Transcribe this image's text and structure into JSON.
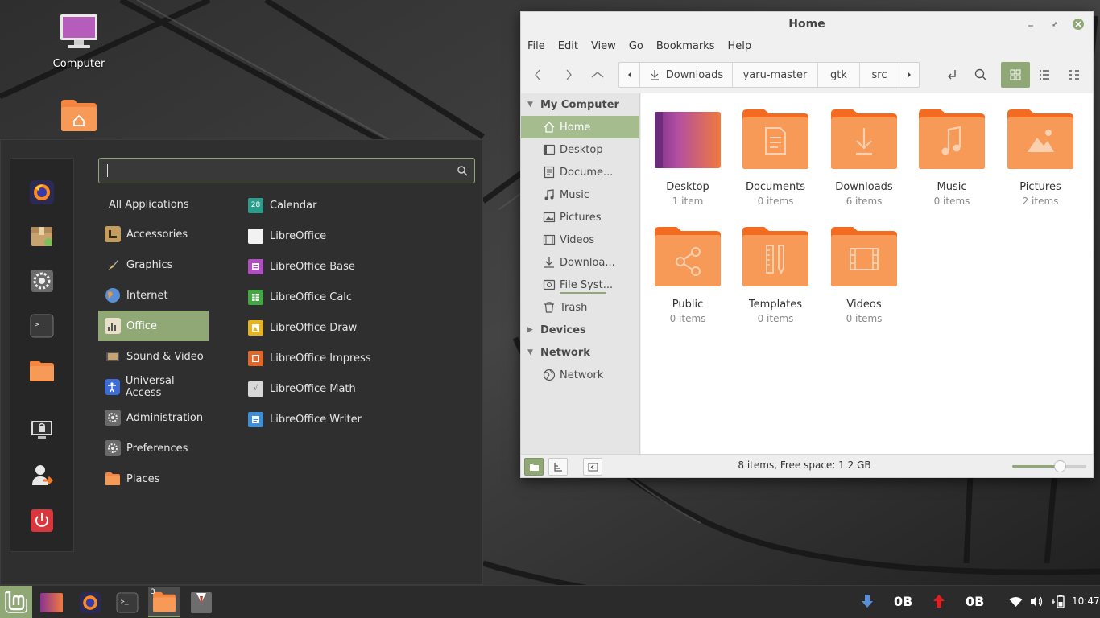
{
  "desktop": {
    "icons": [
      {
        "label": "Computer",
        "icon": "computer-icon"
      },
      {
        "label": "",
        "icon": "home-folder-icon"
      }
    ]
  },
  "menu": {
    "search": {
      "value": "",
      "placeholder": ""
    },
    "favorites": [
      "firefox-icon",
      "package-manager-icon",
      "settings-icon",
      "terminal-icon",
      "folder-icon",
      "lock-screen-icon",
      "logout-icon",
      "power-icon"
    ],
    "categories": [
      {
        "label": "All Applications"
      },
      {
        "label": "Accessories"
      },
      {
        "label": "Graphics"
      },
      {
        "label": "Internet"
      },
      {
        "label": "Office",
        "active": true
      },
      {
        "label": "Sound & Video"
      },
      {
        "label": "Universal Access"
      },
      {
        "label": "Administration"
      },
      {
        "label": "Preferences"
      },
      {
        "label": "Places"
      }
    ],
    "calendar_day": "28",
    "apps": [
      {
        "label": "Calendar"
      },
      {
        "label": "LibreOffice"
      },
      {
        "label": "LibreOffice Base"
      },
      {
        "label": "LibreOffice Calc"
      },
      {
        "label": "LibreOffice Draw"
      },
      {
        "label": "LibreOffice Impress"
      },
      {
        "label": "LibreOffice Math"
      },
      {
        "label": "LibreOffice Writer"
      }
    ]
  },
  "nemo": {
    "title": "Home",
    "menubar": [
      "File",
      "Edit",
      "View",
      "Go",
      "Bookmarks",
      "Help"
    ],
    "pathbar": [
      "Downloads",
      "yaru-master",
      "gtk",
      "src"
    ],
    "sidebar": {
      "my_computer": {
        "heading": "My Computer",
        "items": [
          "Home",
          "Desktop",
          "Docume...",
          "Music",
          "Pictures",
          "Videos",
          "Downloa...",
          "File Syst...",
          "Trash"
        ]
      },
      "devices": {
        "heading": "Devices"
      },
      "network": {
        "heading": "Network",
        "items": [
          "Network"
        ]
      }
    },
    "files": [
      {
        "name": "Desktop",
        "count": "1 item"
      },
      {
        "name": "Documents",
        "count": "0 items"
      },
      {
        "name": "Downloads",
        "count": "6 items"
      },
      {
        "name": "Music",
        "count": "0 items"
      },
      {
        "name": "Pictures",
        "count": "2 items"
      },
      {
        "name": "Public",
        "count": "0 items"
      },
      {
        "name": "Templates",
        "count": "0 items"
      },
      {
        "name": "Videos",
        "count": "0 items"
      }
    ],
    "status": "8 items, Free space: 1.2 GB",
    "zoom_level": 0.65,
    "colors": {
      "accent": "#8fa876",
      "folder": "#f5853f",
      "folder_light": "#f9a66a"
    }
  },
  "panel": {
    "workspace_count": "3",
    "download_rate": "0B",
    "upload_rate": "0B",
    "clock": "10:47"
  }
}
